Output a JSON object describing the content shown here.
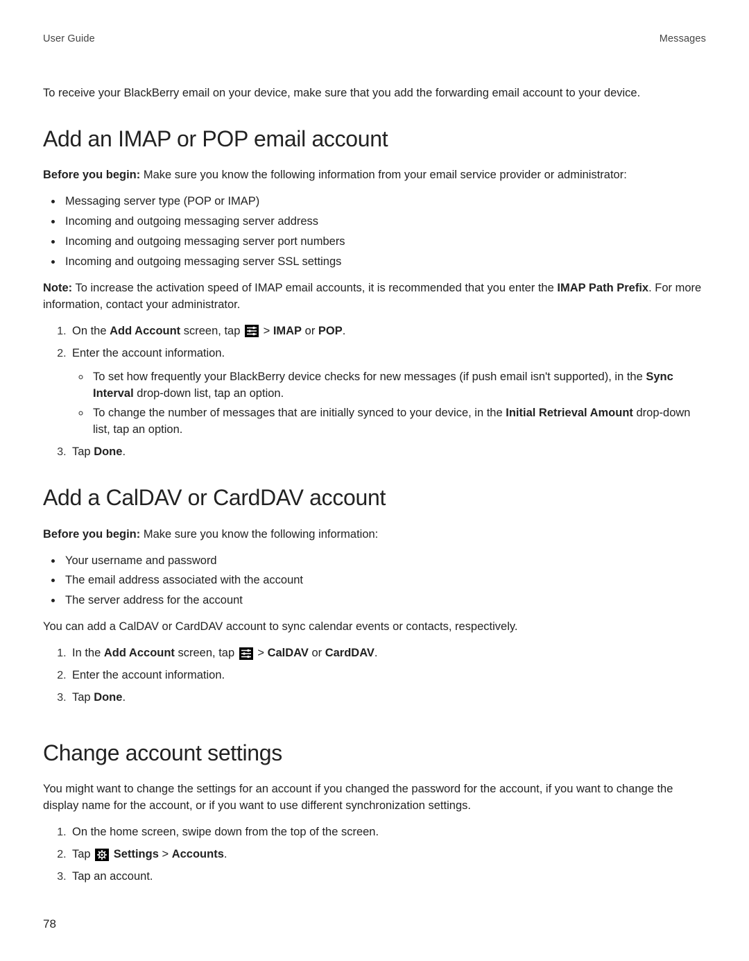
{
  "header": {
    "left": "User Guide",
    "right": "Messages"
  },
  "intro_paragraph": "To receive your BlackBerry email on your device, make sure that you add the forwarding email account to your device.",
  "section_imap": {
    "heading": "Add an IMAP or POP email account",
    "before_label": "Before you begin:",
    "before_text": " Make sure you know the following information from your email service provider or administrator:",
    "bullets": [
      "Messaging server type (POP or IMAP)",
      "Incoming and outgoing messaging server address",
      "Incoming and outgoing messaging server port numbers",
      "Incoming and outgoing messaging server SSL settings"
    ],
    "note_label": "Note:",
    "note_text_1": " To increase the activation speed of IMAP email accounts, it is recommended that you enter the ",
    "note_bold": "IMAP Path Prefix",
    "note_text_2": ". For more information, contact your administrator.",
    "step1_pre": "On the ",
    "step1_bold1": "Add Account",
    "step1_mid": " screen, tap ",
    "step1_gt": " > ",
    "step1_bold2": "IMAP",
    "step1_or": " or ",
    "step1_bold3": "POP",
    "step1_end": ".",
    "step2": "Enter the account information.",
    "step2_sub1_pre": "To set how frequently your BlackBerry device checks for new messages (if push email isn't supported), in the ",
    "step2_sub1_bold": "Sync Interval",
    "step2_sub1_post": " drop-down list, tap an option.",
    "step2_sub2_pre": "To change the number of messages that are initially synced to your device, in the ",
    "step2_sub2_bold": "Initial Retrieval Amount",
    "step2_sub2_post": " drop-down list, tap an option.",
    "step3_pre": "Tap ",
    "step3_bold": "Done",
    "step3_end": "."
  },
  "section_dav": {
    "heading": "Add a CalDAV or CardDAV account",
    "before_label": "Before you begin:",
    "before_text": " Make sure you know the following information:",
    "bullets": [
      "Your username and password",
      "The email address associated with the account",
      "The server address for the account"
    ],
    "paragraph": "You can add a CalDAV or CardDAV account to sync calendar events or contacts, respectively.",
    "step1_pre": "In the ",
    "step1_bold1": "Add Account",
    "step1_mid": " screen, tap ",
    "step1_gt": " > ",
    "step1_bold2": "CalDAV",
    "step1_or": " or ",
    "step1_bold3": "CardDAV",
    "step1_end": ".",
    "step2": "Enter the account information.",
    "step3_pre": "Tap ",
    "step3_bold": "Done",
    "step3_end": "."
  },
  "section_change": {
    "heading": "Change account settings",
    "paragraph": "You might want to change the settings for an account if you changed the password for the account, if you want to change the display name for the account, or if you want to use different synchronization settings.",
    "step1": "On the home screen, swipe down from the top of the screen.",
    "step2_pre": "Tap ",
    "step2_bold1": "Settings",
    "step2_gt": " > ",
    "step2_bold2": "Accounts",
    "step2_end": ".",
    "step3": "Tap an account."
  },
  "page_number": "78"
}
